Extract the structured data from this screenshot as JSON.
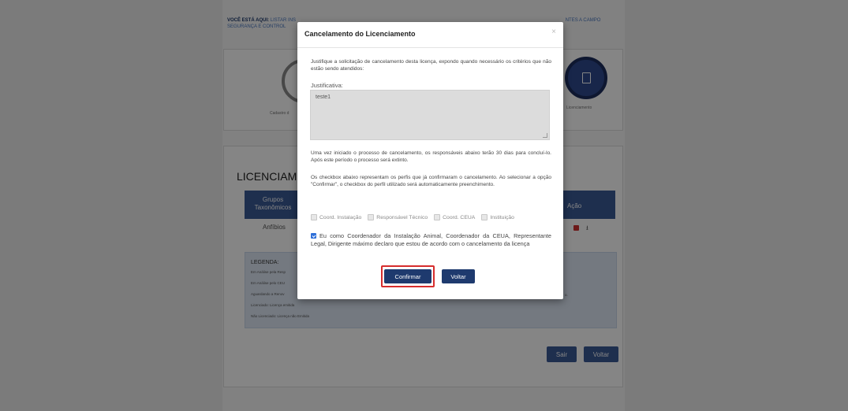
{
  "breadcrumb": {
    "prefix": "VOCÊ ESTÁ AQUI:",
    "link1": "LISTAR INS",
    "link_end": "NTES A CAMPO",
    "line2": "SEGURANÇA E CONTROL"
  },
  "steps": {
    "left_label": "Cadastro d",
    "right_label": "Licenciamento",
    "right_icon": "document-icon"
  },
  "page": {
    "title": "LICENCIAMENT",
    "table": {
      "header_grupos": "Grupos Taxonômicos",
      "header_acao": "Ação",
      "row1_grupo": "Anfíbios"
    },
    "legend": {
      "title": "LEGENDA:",
      "items": [
        "Em Análise pela Resp",
        "Em Análise pelo CEU",
        "Aguardando a Renov",
        "Licenciado: Licença emitida",
        "Não Licenciado: Licença não Emitida"
      ],
      "tail": "o."
    },
    "buttons": {
      "sair": "Sair",
      "voltar": "Voltar"
    }
  },
  "modal": {
    "title": "Cancelamento do Licenciamento",
    "close": "×",
    "intro": "Justifique a solicitação de cancelamento desta licença, expondo quando necessário os critérios que não estão sendo atendidos:",
    "justificativa_label": "Justificativa:",
    "justificativa_value": "teste1",
    "info1": "Uma vez iniciado o processo de cancelamento, os responsáveis abaixo terão 30 dias para concluí-lo. Após este período o processo será extinto.",
    "info2": "Os checkbox abaixo representam os perfis que já confirmaram o cancelamento. Ao selecionar a opção \"Confirmar\", o checkbox do perfil utilizado será automaticamente preenchimento.",
    "profiles": [
      "Coord. Instalação",
      "Responsável Técnico",
      "Coord. CEUA",
      "Instituição"
    ],
    "agree": "Eu como Coordenador da Instalação Animal, Coordenador da CEUA, Representante Legal, Dirigente máximo declaro que estou de acordo com o cancelamento da licença",
    "confirm_label": "Confirmar",
    "back_label": "Voltar"
  },
  "colors": {
    "primary": "#1e3a6e",
    "table_header": "#3b5a96",
    "highlight": "#d62d2d",
    "checkbox": "#2f6fd8"
  }
}
